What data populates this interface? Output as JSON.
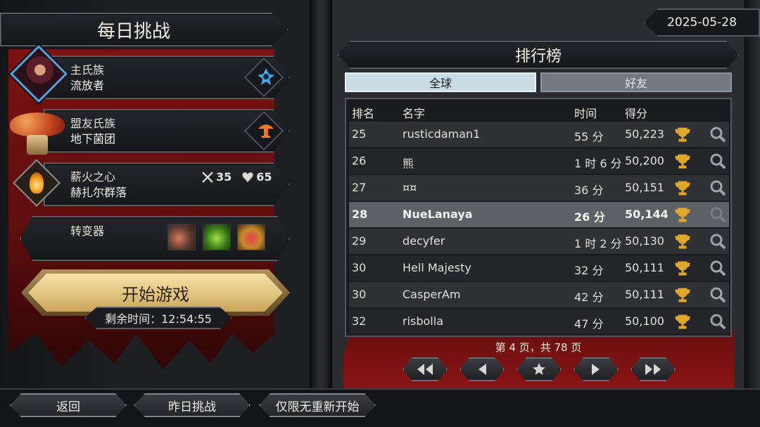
{
  "title": "每日挑战",
  "date": "2025-05-28",
  "rows": {
    "main_clan": {
      "label": "主氏族",
      "value": "流放者"
    },
    "ally_clan": {
      "label": "盟友氏族",
      "value": "地下菌团"
    },
    "hearth": {
      "label": "薪火之心",
      "value": "赫扎尔群落",
      "stat_attack": "35",
      "stat_health": "65"
    },
    "mutators": {
      "label": "转变器"
    }
  },
  "start_button": "开始游戏",
  "timer": "剩余时间：12:54:55",
  "leaderboard": {
    "title": "排行榜",
    "tabs": [
      "全球",
      "好友"
    ],
    "active_tab": "全球",
    "columns": [
      "排名",
      "名字",
      "时间",
      "得分"
    ],
    "rows": [
      {
        "rank": "25",
        "name": "rusticdaman1",
        "time": "55 分",
        "score": "50,223"
      },
      {
        "rank": "26",
        "name": "熊",
        "time": "1 时 6 分",
        "score": "50,200"
      },
      {
        "rank": "27",
        "name": "¤¤",
        "time": "36 分",
        "score": "50,151"
      },
      {
        "rank": "28",
        "name": "NueLanaya",
        "time": "26 分",
        "score": "50,144"
      },
      {
        "rank": "29",
        "name": "decyfer",
        "time": "1 时 2 分",
        "score": "50,130"
      },
      {
        "rank": "30",
        "name": "Hell Majesty",
        "time": "32 分",
        "score": "50,111"
      },
      {
        "rank": "30",
        "name": "CasperAm",
        "time": "42 分",
        "score": "50,111"
      },
      {
        "rank": "32",
        "name": "risbolla",
        "time": "47 分",
        "score": "50,100"
      }
    ],
    "highlighted_row": "NueLanaya",
    "page_info": "第 4 页，共 78 页"
  },
  "bottom_buttons": {
    "back": "返回",
    "yesterday": "昨日挑战",
    "no_restart": "仅限无重新开始"
  },
  "colors": {
    "banner_red": "#7a1212",
    "accent_gold": "#e1c47d",
    "trophy_gold": "#e0a72a",
    "tab_active": "#c9dde4",
    "tab_inactive": "#727980",
    "highlight_row": "#5c6166",
    "avatar_border": "#4aa7e0",
    "clan_emblem_blue": "#3fa6e8",
    "ally_emblem_orange": "#f0772a"
  },
  "icons": {
    "nav": [
      "first-page-icon",
      "previous-page-icon",
      "star-icon",
      "next-page-icon",
      "last-page-icon"
    ]
  }
}
